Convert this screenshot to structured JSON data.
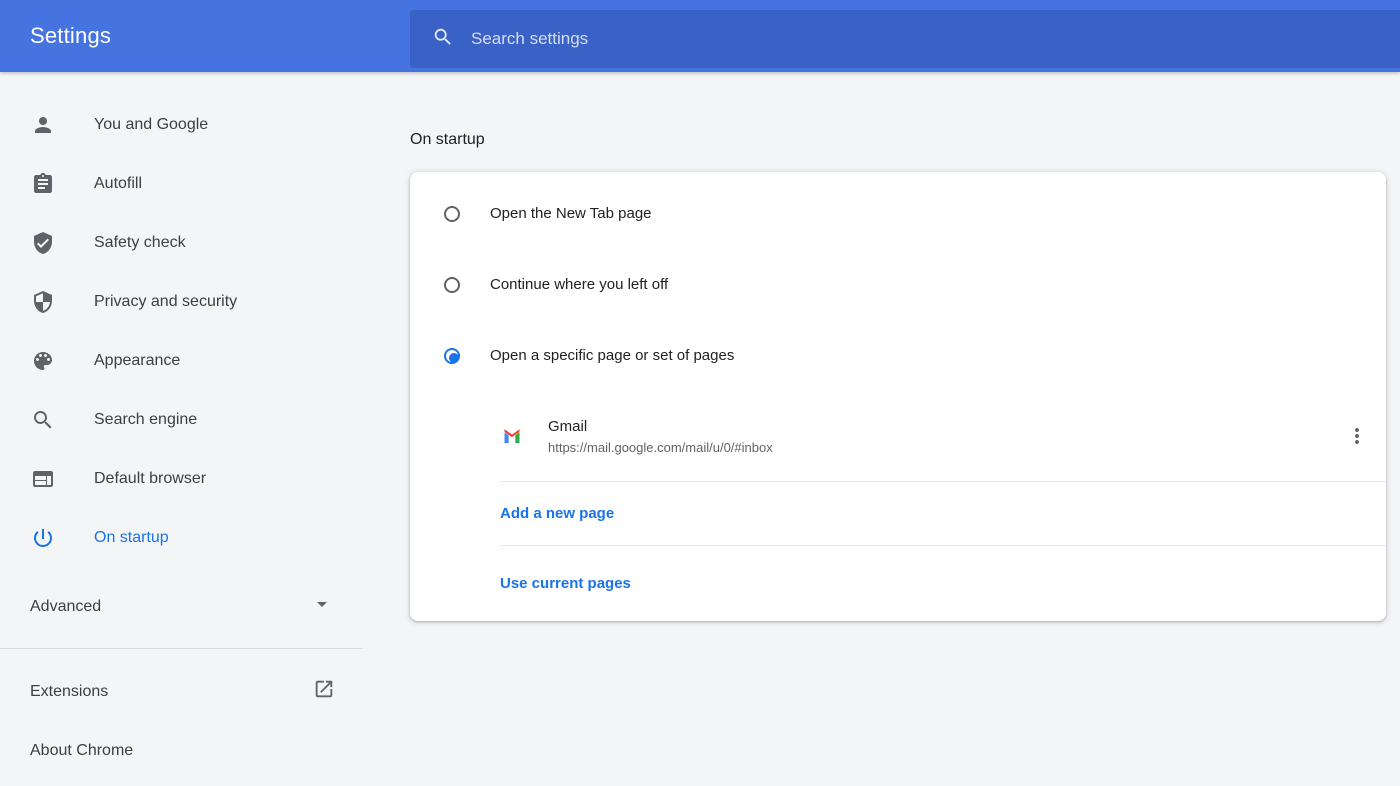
{
  "header": {
    "title": "Settings",
    "search": {
      "placeholder": "Search settings",
      "icon": "search-icon"
    }
  },
  "sidebar": {
    "items": [
      {
        "label": "You and Google",
        "icon": "person-icon",
        "selected": false
      },
      {
        "label": "Autofill",
        "icon": "clipboard-icon",
        "selected": false
      },
      {
        "label": "Safety check",
        "icon": "shield-check-icon",
        "selected": false
      },
      {
        "label": "Privacy and security",
        "icon": "shield-half-icon",
        "selected": false
      },
      {
        "label": "Appearance",
        "icon": "palette-icon",
        "selected": false
      },
      {
        "label": "Search engine",
        "icon": "magnifier-icon",
        "selected": false
      },
      {
        "label": "Default browser",
        "icon": "browser-window-icon",
        "selected": false
      },
      {
        "label": "On startup",
        "icon": "power-icon",
        "selected": true
      }
    ],
    "advanced": {
      "label": "Advanced",
      "icon": "chevron-down-icon",
      "expanded": false
    },
    "extensions": {
      "label": "Extensions",
      "icon": "external-link-icon"
    },
    "about": {
      "label": "About Chrome"
    }
  },
  "main": {
    "section_title": "On startup",
    "radio_options": [
      {
        "label": "Open the New Tab page",
        "selected": false
      },
      {
        "label": "Continue where you left off",
        "selected": false
      },
      {
        "label": "Open a specific page or set of pages",
        "selected": true
      }
    ],
    "startup_pages": [
      {
        "title": "Gmail",
        "url": "https://mail.google.com/mail/u/0/#inbox",
        "favicon": "gmail-icon",
        "menu_icon": "more-vert-icon"
      }
    ],
    "add_page_label": "Add a new page",
    "use_current_label": "Use current pages"
  },
  "colors": {
    "accent": "#1a73e8",
    "header_bg": "#4573df",
    "search_bg": "#3a62c6",
    "text_primary": "#202124",
    "text_secondary": "#5f6368",
    "sidebar_text": "#3c4043",
    "page_bg": "#f4f5f7",
    "card_bg": "#ffffff"
  }
}
